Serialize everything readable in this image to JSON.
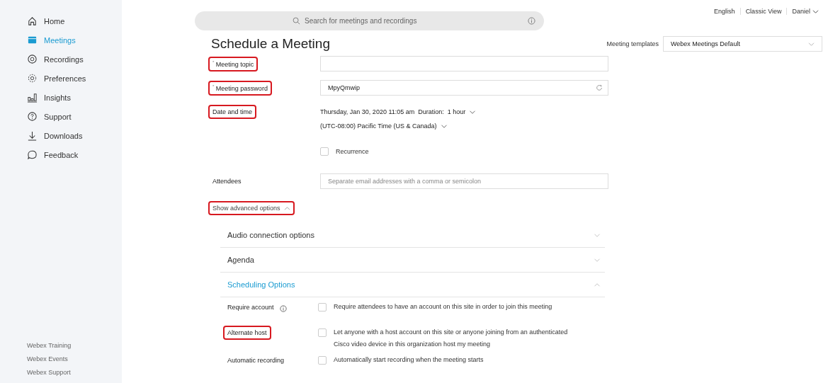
{
  "sidebar": {
    "items": [
      {
        "label": "Home",
        "selected": false
      },
      {
        "label": "Meetings",
        "selected": true
      },
      {
        "label": "Recordings",
        "selected": false
      },
      {
        "label": "Preferences",
        "selected": false
      },
      {
        "label": "Insights",
        "selected": false
      },
      {
        "label": "Support",
        "selected": false
      },
      {
        "label": "Downloads",
        "selected": false
      },
      {
        "label": "Feedback",
        "selected": false
      }
    ],
    "footer_links": [
      "Webex Training",
      "Webex Events",
      "Webex Support"
    ]
  },
  "search": {
    "placeholder": "Search for meetings and recordings"
  },
  "header_links": [
    "English",
    "Classic View",
    "Daniel"
  ],
  "title": "Schedule a Meeting",
  "templates": {
    "label": "Meeting templates",
    "value": "Webex Meetings Default"
  },
  "topic": {
    "label": "$^{*}$ Meeting topic",
    "highlighted": true
  },
  "password": {
    "label": "$^{*}$ Meeting password",
    "highlighted": true,
    "value": "MpyQmwip"
  },
  "date_time": {
    "label": "Date and time",
    "highlighted": true,
    "datetime": "Thursday, Jan 30, 2020 11:05 am",
    "duration_label": "Duration:",
    "duration": "1 hour",
    "timezone": "(UTC-08:00) Pacific Time (US & Canada)"
  },
  "recurrence": {
    "label": "Recurrence",
    "checked": false
  },
  "attendees": {
    "label": "Attendees",
    "highlighted": false,
    "placeholder": "Separate email addresses with a comma or semicolon"
  },
  "advanced": {
    "label": "Show advanced options",
    "highlighted": true,
    "expanded": true
  },
  "sections": [
    {
      "title": "Audio connection options",
      "expanded": false
    },
    {
      "title": "Agenda",
      "expanded": false
    },
    {
      "title": "Scheduling Options",
      "expanded": true
    }
  ],
  "options": [
    {
      "label": "Require account",
      "info": true,
      "highlighted": false,
      "checked": false,
      "text": "Require attendees to have an account on this site in order to join this meeting"
    },
    {
      "label": "Alternate host",
      "info": false,
      "highlighted": true,
      "checked": false,
      "text": "Let anyone with a host account on this site or anyone joining from an authenticated Cisco video device in this organization host my meeting"
    },
    {
      "label": "Automatic recording",
      "info": false,
      "highlighted": false,
      "checked": false,
      "text": "Automatically start recording when the meeting starts"
    }
  ]
}
